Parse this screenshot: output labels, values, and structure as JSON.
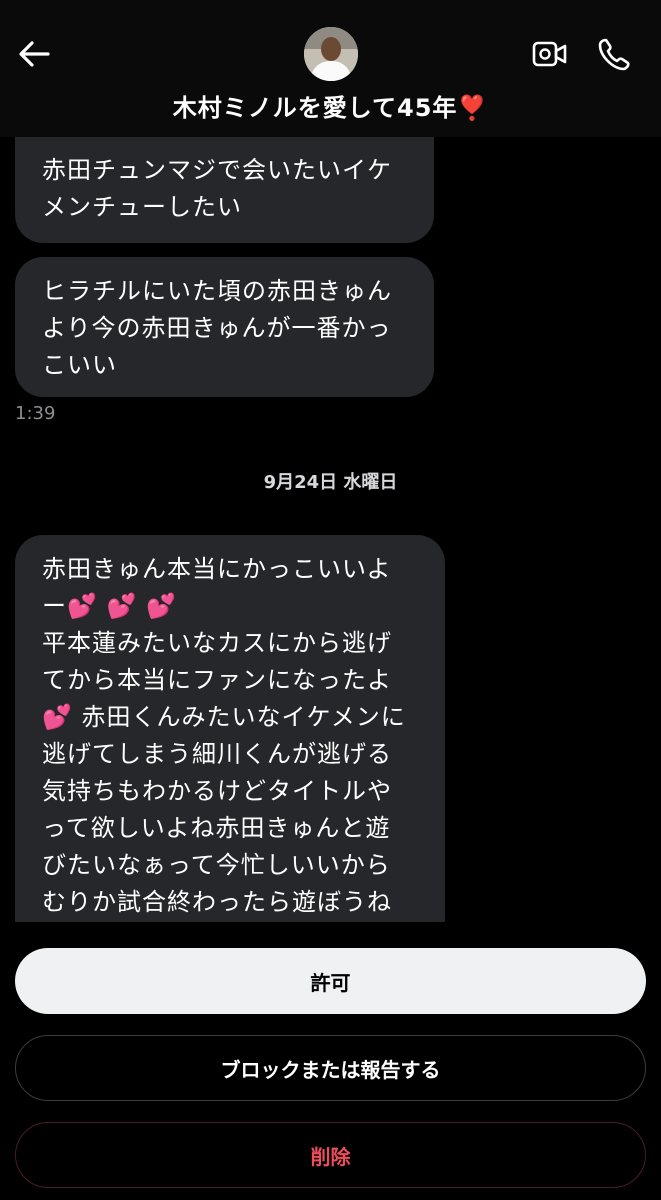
{
  "header": {
    "title": "木村ミノルを愛して45年❣️",
    "back_icon": "arrow-left-icon",
    "video_icon": "video-camera-icon",
    "call_icon": "phone-icon"
  },
  "messages": [
    {
      "text": "赤田チュンマジで会いたいイケ\nメンチューしたい"
    },
    {
      "text": "ヒラチルにいた頃の赤田きゅん\nより今の赤田きゅんが一番かっ\nこいい"
    },
    {
      "text": "赤田きゅん本当にかっこいいよ\nー💕 💕 💕\n平本蓮みたいなカスにから逃げ\nてから本当にファンになったよ\n💕 赤田くんみたいなイケメンに\n逃げてしまう細川くんが逃げる\n気持ちもわかるけどタイトルや\nって欲しいよね赤田きゅんと遊\nびたいなぁって今忙しいいから\nむりか試合終わったら遊ぼうね\n💕 💕 💕 💕 💕 💕 💕 💕"
    }
  ],
  "timestamp": "1:39",
  "date_divider": "9月24日 水曜日",
  "actions": {
    "allow": "許可",
    "block_report": "ブロックまたは報告する",
    "delete": "削除"
  },
  "colors": {
    "bubble": "#26272b",
    "allow_bg": "#f0f1f3",
    "delete_text": "#ef4d5c"
  }
}
